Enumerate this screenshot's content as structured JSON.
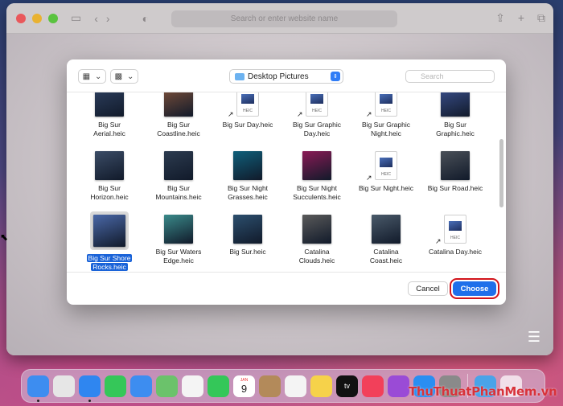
{
  "browser": {
    "url_placeholder": "Search or enter website name"
  },
  "dialog": {
    "location": "Desktop Pictures",
    "search_placeholder": "Search",
    "cancel_label": "Cancel",
    "choose_label": "Choose",
    "files": [
      {
        "name": "Big Sur Aerial.heic",
        "lines": [
          "Big Sur",
          "Aerial.heic"
        ],
        "thumb": "#2d3f5e"
      },
      {
        "name": "Big Sur Coastline.heic",
        "lines": [
          "Big Sur",
          "Coastline.heic"
        ],
        "thumb": "#7a4f3a"
      },
      {
        "name": "Big Sur Day.heic",
        "lines": [
          "Big Sur Day.heic"
        ],
        "heic": true
      },
      {
        "name": "Big Sur Graphic Day.heic",
        "lines": [
          "Big Sur Graphic",
          "Day.heic"
        ],
        "heic": true
      },
      {
        "name": "Big Sur Graphic Night.heic",
        "lines": [
          "Big Sur Graphic",
          "Night.heic"
        ],
        "heic": true
      },
      {
        "name": "Big Sur Graphic.heic",
        "lines": [
          "Big Sur",
          "Graphic.heic"
        ],
        "thumb": "#3a4f8c"
      },
      {
        "name": "Big Sur Horizon.heic",
        "lines": [
          "Big Sur",
          "Horizon.heic"
        ],
        "thumb": "#3b4c66"
      },
      {
        "name": "Big Sur Mountains.heic",
        "lines": [
          "Big Sur",
          "Mountains.heic"
        ],
        "thumb": "#2c3b4f"
      },
      {
        "name": "Big Sur Night Grasses.heic",
        "lines": [
          "Big Sur Night",
          "Grasses.heic"
        ],
        "thumb": "#0f5f7a"
      },
      {
        "name": "Big Sur Night Succulents.heic",
        "lines": [
          "Big Sur Night",
          "Succulents.heic"
        ],
        "thumb": "#8a1a55"
      },
      {
        "name": "Big Sur Night.heic",
        "lines": [
          "Big Sur Night.heic"
        ],
        "heic": true
      },
      {
        "name": "Big Sur Road.heic",
        "lines": [
          "Big Sur Road.heic"
        ],
        "thumb": "#4a5058"
      },
      {
        "name": "Big Sur Shore Rocks.heic",
        "lines": [
          "Big Sur Shore",
          "Rocks.heic"
        ],
        "thumb": "#4a68a8",
        "selected": true
      },
      {
        "name": "Big Sur Waters Edge.heic",
        "lines": [
          "Big Sur Waters",
          "Edge.heic"
        ],
        "thumb": "#3a8a8a"
      },
      {
        "name": "Big Sur.heic",
        "lines": [
          "Big Sur.heic"
        ],
        "thumb": "#2c4f6e"
      },
      {
        "name": "Catalina Clouds.heic",
        "lines": [
          "Catalina",
          "Clouds.heic"
        ],
        "thumb": "#5a5a5a"
      },
      {
        "name": "Catalina Coast.heic",
        "lines": [
          "Catalina",
          "Coast.heic"
        ],
        "thumb": "#4a5a6a"
      },
      {
        "name": "Catalina Day.heic",
        "lines": [
          "Catalina Day.heic"
        ],
        "heic": true
      }
    ],
    "partial_row_colors": [
      "#5a6a80",
      "#e8e8e8",
      "#4a5a50",
      "#d8d4cc",
      "#3a4050",
      "#708090"
    ]
  },
  "dock": {
    "calendar_month": "JAN",
    "calendar_day": "9",
    "apps": [
      {
        "icon": "finder-icon",
        "color": "#3d8df0",
        "running": true
      },
      {
        "icon": "launchpad-icon",
        "color": "#e6e6e6"
      },
      {
        "icon": "safari-icon",
        "color": "#2f86f0",
        "running": true
      },
      {
        "icon": "messages-icon",
        "color": "#35c759"
      },
      {
        "icon": "mail-icon",
        "color": "#3d8df0"
      },
      {
        "icon": "maps-icon",
        "color": "#6bc26b"
      },
      {
        "icon": "photos-icon",
        "color": "#f4f4f4"
      },
      {
        "icon": "facetime-icon",
        "color": "#34c759"
      },
      {
        "icon": "calendar-icon",
        "color": "#ffffff"
      },
      {
        "icon": "contacts-icon",
        "color": "#b38a5a"
      },
      {
        "icon": "reminders-icon",
        "color": "#f4f4f4"
      },
      {
        "icon": "notes-icon",
        "color": "#f6d24a"
      },
      {
        "icon": "appletv-icon",
        "color": "#111111"
      },
      {
        "icon": "music-icon",
        "color": "#f2405a"
      },
      {
        "icon": "podcasts-icon",
        "color": "#9a4bd6"
      },
      {
        "icon": "appstore-icon",
        "color": "#2a8ef2"
      },
      {
        "icon": "system-preferences-icon",
        "color": "#8a8a8a"
      }
    ],
    "apple_tv_label": "tv"
  },
  "watermark": "ThuThuatPhanMem.vn",
  "colors": {
    "accent": "#1f6fea",
    "highlight": "#d2141b"
  }
}
